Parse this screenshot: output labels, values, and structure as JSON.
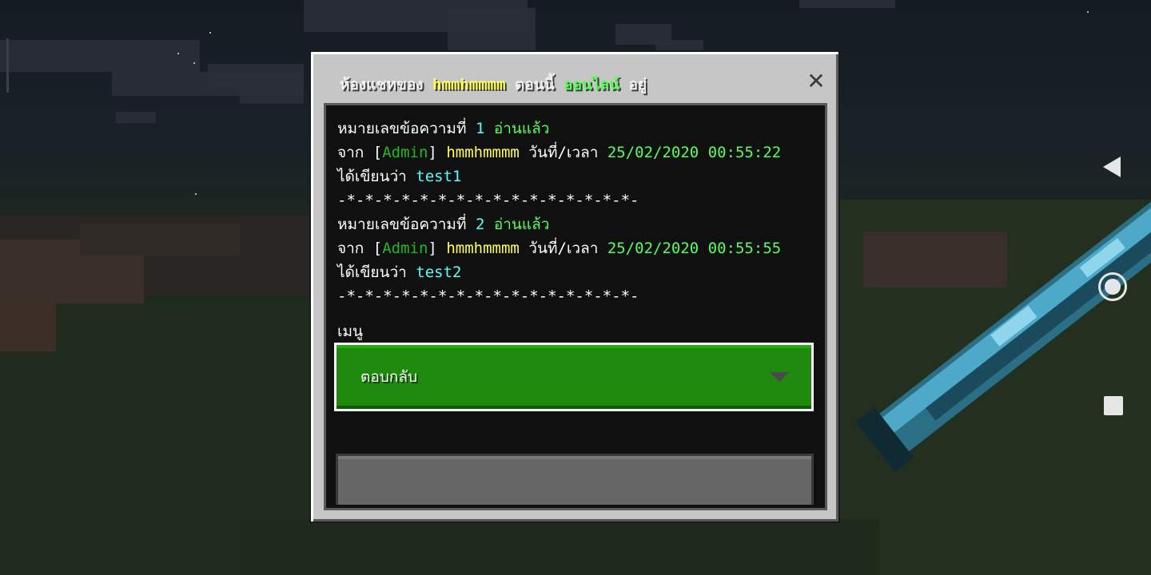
{
  "dialog": {
    "title": {
      "prefix": "ห้องแชทของ",
      "player": "hmmhmmmm",
      "middle": "ตอนนี้",
      "status": "ออนไลน์",
      "suffix": "อยู่"
    },
    "close_label": "✕"
  },
  "messages": [
    {
      "number_label": "หมายเลขข้อความที่",
      "number": "1",
      "read_status": "อ่านแล้ว",
      "from_label": "จาก",
      "rank": "Admin",
      "sender": "hmmhmmmm",
      "datetime_label": "วันที่/เวลา",
      "datetime": "25/02/2020 00:55:22",
      "wrote_label": "ได้เขียนว่า",
      "text": "test1",
      "separator": "-*-*-*-*-*-*-*-*-*-*-*-*-*-*-*-*-"
    },
    {
      "number_label": "หมายเลขข้อความที่",
      "number": "2",
      "read_status": "อ่านแล้ว",
      "from_label": "จาก",
      "rank": "Admin",
      "sender": "hmmhmmmm",
      "datetime_label": "วันที่/เวลา",
      "datetime": "25/02/2020 00:55:55",
      "wrote_label": "ได้เขียนว่า",
      "text": "test2",
      "separator": "-*-*-*-*-*-*-*-*-*-*-*-*-*-*-*-*-"
    }
  ],
  "menu": {
    "label": "เมนู",
    "selected": "ตอบกลับ"
  },
  "input": {
    "value": ""
  },
  "colors": {
    "accent_green": "#1f8a0e",
    "yellow": "#ffff55",
    "aqua": "#55ffff",
    "light_green": "#55ff55"
  },
  "nav": {
    "back_icon": "back-triangle-icon",
    "home_icon": "home-circle-icon",
    "recent_icon": "recent-square-icon"
  }
}
